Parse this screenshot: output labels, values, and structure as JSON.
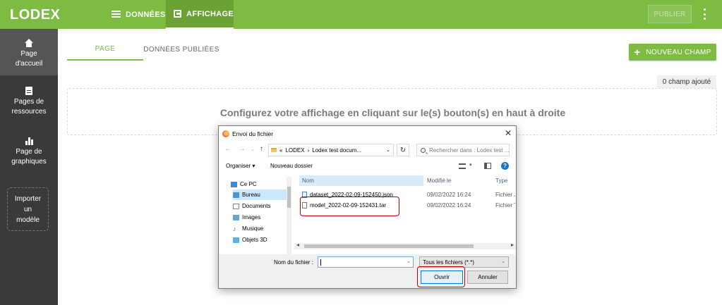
{
  "app": {
    "logo": "LODEX"
  },
  "topbar": {
    "tabs": [
      {
        "label": "DONNÉES",
        "icon": "list-icon"
      },
      {
        "label": "AFFICHAGE",
        "icon": "display-icon"
      }
    ],
    "publish_label": "PUBLIER",
    "colors": {
      "brand": "#7dbb42",
      "brand_dark": "#6aa233"
    }
  },
  "sidebar": {
    "items": [
      {
        "label_line1": "Page",
        "label_line2": "d'accueil",
        "icon": "home-icon",
        "active": true
      },
      {
        "label_line1": "Pages de",
        "label_line2": "ressources",
        "icon": "document-icon"
      },
      {
        "label_line1": "Page de",
        "label_line2": "graphiques",
        "icon": "bar-chart-icon"
      }
    ],
    "import": {
      "line1": "Importer",
      "line2": "un",
      "line3": "modèle"
    }
  },
  "main": {
    "tabs": [
      {
        "label": "PAGE"
      },
      {
        "label": "DONNÉES PUBLIÉES"
      }
    ],
    "new_field_label": "NOUVEAU CHAMP",
    "field_count": "0 champ ajouté",
    "empty_message": "Configurez votre affichage en cliquant sur le(s) bouton(s) en haut à droite"
  },
  "dialog": {
    "title": "Envoi du fichier",
    "breadcrumb": {
      "sep": "«",
      "part1": "LODEX",
      "arrow": "›",
      "part2": "Lodex test docum..."
    },
    "search_placeholder": "Rechercher dans : Lodex test ...",
    "organise": "Organiser ▾",
    "new_folder": "Nouveau dossier",
    "nav": [
      {
        "label": "Ce PC",
        "icon": "pc-icon",
        "color": "#3c8ad8"
      },
      {
        "label": "Bureau",
        "icon": "desktop-icon",
        "color": "#4c96d8",
        "selected": true
      },
      {
        "label": "Documents",
        "icon": "documents-icon",
        "color": "#888888"
      },
      {
        "label": "Images",
        "icon": "images-icon",
        "color": "#6aa4d6"
      },
      {
        "label": "Musique",
        "icon": "music-icon",
        "color": "#2e6fb8"
      },
      {
        "label": "Objets 3D",
        "icon": "objects3d-icon",
        "color": "#5ab0e8"
      }
    ],
    "columns": {
      "name": "Nom",
      "modified": "Modifié le",
      "type": "Type"
    },
    "files": [
      {
        "name": "dataset_2022-02-09-152450.json",
        "date": "09/02/2022 16:24",
        "type": "Fichier JS",
        "kind": "json"
      },
      {
        "name": "model_2022-02-09-152431.tar",
        "date": "09/02/2022 16:24",
        "type": "Fichier TA",
        "kind": "tar"
      }
    ],
    "filename_label": "Nom du fichier :",
    "filename_value": "",
    "filter": "Tous les fichiers (*.*)",
    "open_label": "Ouvrir",
    "cancel_label": "Annuler",
    "highlight_color": "#c00000"
  }
}
